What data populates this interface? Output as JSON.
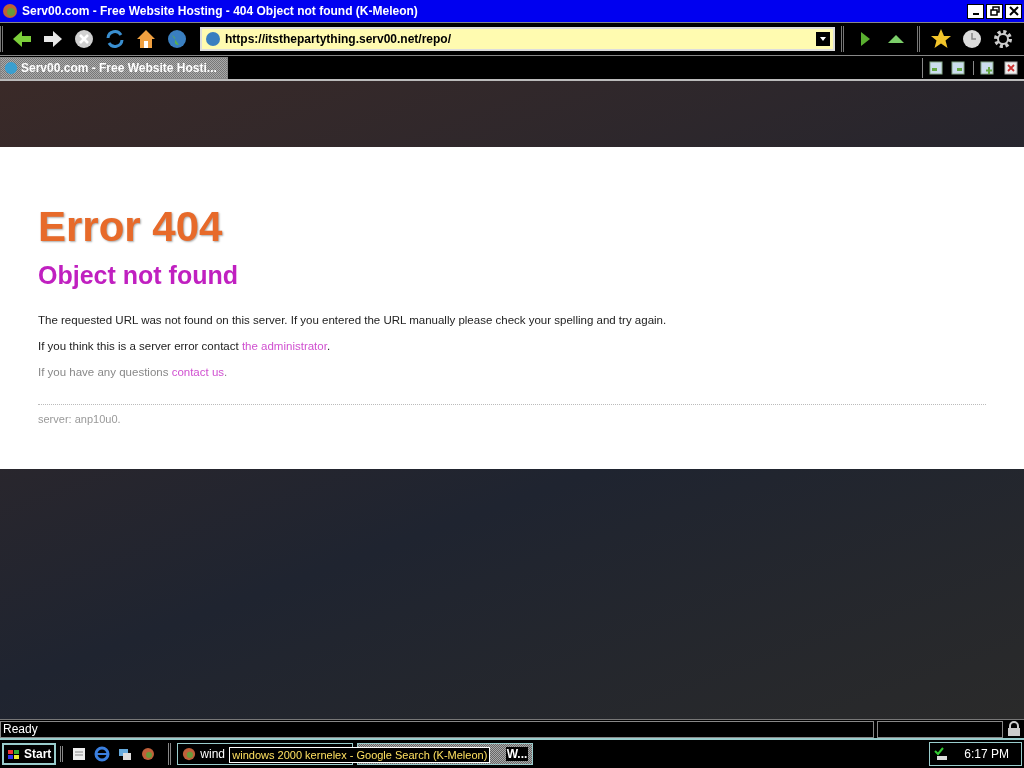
{
  "window": {
    "title": "Serv00.com - Free Website Hosting - 404 Object not found (K-Meleon)"
  },
  "address_bar": {
    "value": "https://itsthepartything.serv00.net/repo/"
  },
  "tabs": [
    {
      "label": "Serv00.com - Free Website Hosti...",
      "selected": true
    }
  ],
  "page": {
    "heading": "Error 404",
    "subheading": "Object not found",
    "paragraphs": [
      {
        "text": "The requested URL was not found on this server. If you entered the URL manually please check your spelling and try again."
      },
      {
        "text": "If you think this is a server error contact ",
        "link": "the administrator",
        "after": "."
      },
      {
        "text": "If you have any questions ",
        "link": "contact us",
        "after": "."
      }
    ],
    "footer": "server: anp10u0."
  },
  "status_bar": {
    "text": "Ready"
  },
  "taskbar": {
    "start": "Start",
    "buttons": [
      {
        "label": "wind",
        "selected": false
      },
      {
        "label": "W...",
        "selected": true
      }
    ],
    "tooltip": "windows 2000 kernelex - Google Search (K-Meleon)",
    "clock": "6:17 PM"
  }
}
